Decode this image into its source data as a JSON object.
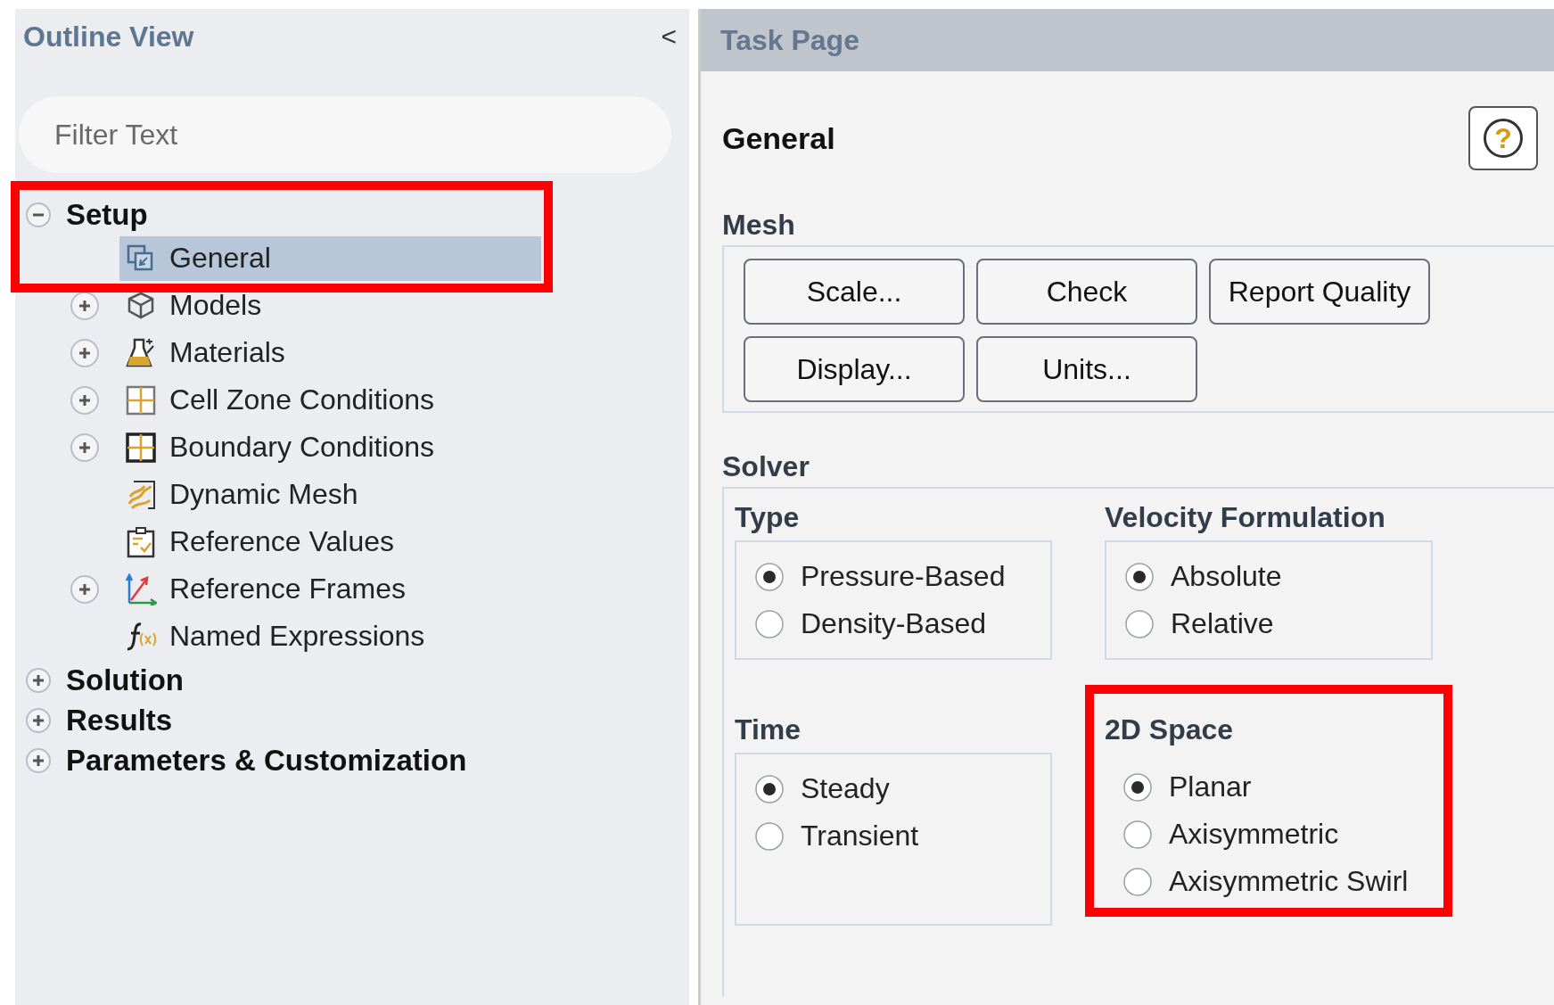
{
  "outline": {
    "title": "Outline View",
    "collapse": "<",
    "filter": {
      "placeholder": "Filter Text"
    },
    "tree": [
      {
        "label": "Setup",
        "expandable": true,
        "expanded": true,
        "highlighted": true,
        "children": [
          {
            "label": "General",
            "expandable": false,
            "selected": true
          },
          {
            "label": "Models",
            "expandable": true,
            "expanded": false,
            "selected": false
          },
          {
            "label": "Materials",
            "expandable": true,
            "expanded": false,
            "selected": false
          },
          {
            "label": "Cell Zone Conditions",
            "expandable": true,
            "expanded": false,
            "selected": false
          },
          {
            "label": "Boundary Conditions",
            "expandable": true,
            "expanded": false,
            "selected": false
          },
          {
            "label": "Dynamic Mesh",
            "expandable": false,
            "selected": false
          },
          {
            "label": "Reference Values",
            "expandable": false,
            "selected": false
          },
          {
            "label": "Reference Frames",
            "expandable": true,
            "expanded": false,
            "selected": false
          },
          {
            "label": "Named Expressions",
            "expandable": false,
            "selected": false
          }
        ]
      },
      {
        "label": "Solution",
        "expandable": true,
        "expanded": false,
        "highlighted": false
      },
      {
        "label": "Results",
        "expandable": true,
        "expanded": false,
        "highlighted": false
      },
      {
        "label": "Parameters & Customization",
        "expandable": true,
        "expanded": false,
        "highlighted": false
      }
    ]
  },
  "task_page": {
    "title": "Task Page",
    "heading": "General",
    "help": "?",
    "mesh": {
      "title": "Mesh",
      "buttons": [
        "Scale...",
        "Check",
        "Report Quality",
        "Display...",
        "Units..."
      ]
    },
    "solver": {
      "title": "Solver",
      "groups": [
        {
          "title": "Type",
          "framed": true,
          "highlighted": false,
          "options": [
            {
              "label": "Pressure-Based",
              "selected": true
            },
            {
              "label": "Density-Based",
              "selected": false
            }
          ]
        },
        {
          "title": "Velocity Formulation",
          "framed": true,
          "highlighted": false,
          "options": [
            {
              "label": "Absolute",
              "selected": true
            },
            {
              "label": "Relative",
              "selected": false
            }
          ]
        },
        {
          "title": "Time",
          "framed": true,
          "highlighted": false,
          "options": [
            {
              "label": "Steady",
              "selected": true
            },
            {
              "label": "Transient",
              "selected": false
            }
          ]
        },
        {
          "title": "2D Space",
          "framed": false,
          "highlighted": true,
          "options": [
            {
              "label": "Planar",
              "selected": true
            },
            {
              "label": "Axisymmetric",
              "selected": false
            },
            {
              "label": "Axisymmetric Swirl",
              "selected": false
            }
          ]
        }
      ]
    }
  }
}
